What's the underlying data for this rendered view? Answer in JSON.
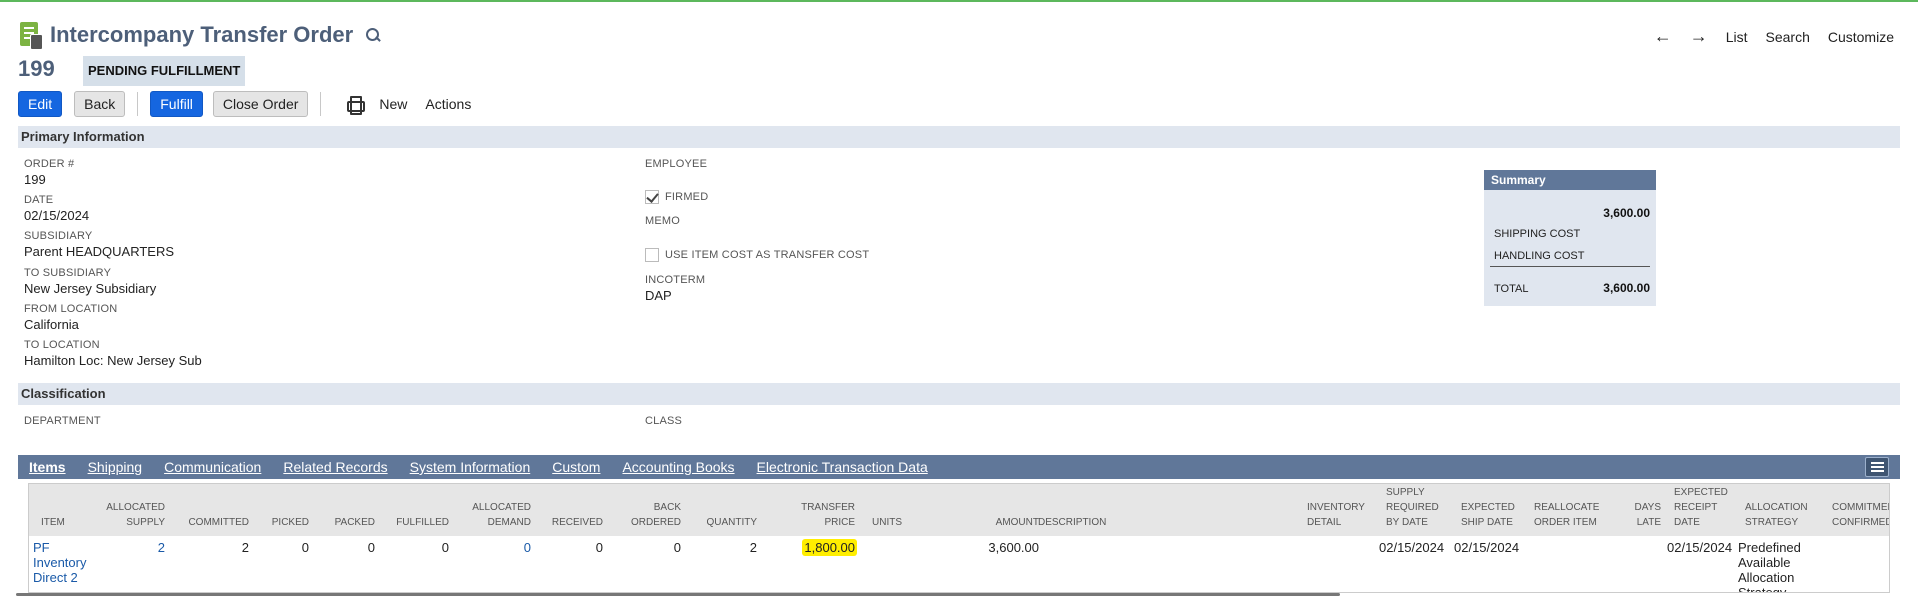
{
  "header": {
    "title": "Intercompany Transfer Order",
    "order_id": "199",
    "status": "PENDING FULFILLMENT"
  },
  "nav": {
    "back_arrow": "←",
    "forward_arrow": "→",
    "list": "List",
    "search": "Search",
    "customize": "Customize"
  },
  "toolbar": {
    "edit": "Edit",
    "back": "Back",
    "fulfill": "Fulfill",
    "close_order": "Close Order",
    "new": "New",
    "actions": "Actions"
  },
  "primary": {
    "section_title": "Primary Information",
    "order_label": "ORDER #",
    "order_value": "199",
    "date_label": "DATE",
    "date_value": "02/15/2024",
    "subsidiary_label": "SUBSIDIARY",
    "subsidiary_value": "Parent HEADQUARTERS",
    "to_subsidiary_label": "TO SUBSIDIARY",
    "to_subsidiary_value": "New Jersey Subsidiary",
    "from_location_label": "FROM LOCATION",
    "from_location_value": "California",
    "to_location_label": "TO LOCATION",
    "to_location_value": "Hamilton Loc: New Jersey Sub",
    "employee_label": "EMPLOYEE",
    "firmed_label": "FIRMED",
    "firmed_checked": true,
    "memo_label": "MEMO",
    "use_item_cost_label": "USE ITEM COST AS TRANSFER COST",
    "use_item_cost_checked": false,
    "incoterm_label": "INCOTERM",
    "incoterm_value": "DAP"
  },
  "summary": {
    "title": "Summary",
    "subtotal": "3,600.00",
    "shipping_cost_label": "SHIPPING COST",
    "handling_cost_label": "HANDLING COST",
    "total_label": "TOTAL",
    "total_value": "3,600.00"
  },
  "classification": {
    "section_title": "Classification",
    "department_label": "DEPARTMENT",
    "class_label": "CLASS"
  },
  "tabs": [
    {
      "label": "Items",
      "active": true
    },
    {
      "label": "Shipping",
      "active": false
    },
    {
      "label": "Communication",
      "active": false
    },
    {
      "label": "Related Records",
      "active": false
    },
    {
      "label": "System Information",
      "active": false
    },
    {
      "label": "Custom",
      "active": false
    },
    {
      "label": "Accounting Books",
      "active": false
    },
    {
      "label": "Electronic Transaction Data",
      "active": false
    }
  ],
  "items_table": {
    "columns": [
      "ITEM",
      "ALLOCATED SUPPLY",
      "COMMITTED",
      "PICKED",
      "PACKED",
      "FULFILLED",
      "ALLOCATED DEMAND",
      "RECEIVED",
      "BACK ORDERED",
      "QUANTITY",
      "TRANSFER PRICE",
      "UNITS",
      "AMOUNT",
      "DESCRIPTION",
      "INVENTORY DETAIL",
      "SUPPLY REQUIRED BY DATE",
      "EXPECTED SHIP DATE",
      "REALLOCATE ORDER ITEM",
      "DAYS LATE",
      "EXPECTED RECEIPT DATE",
      "ALLOCATION STRATEGY",
      "COMMITMEN CONFIRMED"
    ],
    "rows": [
      {
        "item": "PF Inventory Direct 2",
        "allocated_supply": "2",
        "committed": "2",
        "picked": "0",
        "packed": "0",
        "fulfilled": "0",
        "allocated_demand": "0",
        "received": "0",
        "back_ordered": "0",
        "quantity": "2",
        "transfer_price": "1,800.00",
        "units": "",
        "amount": "3,600.00",
        "description": "",
        "inventory_detail": "",
        "supply_required_by_date": "02/15/2024",
        "expected_ship_date": "02/15/2024",
        "reallocate_order_item": "",
        "days_late": "",
        "expected_receipt_date": "02/15/2024",
        "allocation_strategy": "Predefined Available Allocation Strategy",
        "commitment_confirmed": ""
      }
    ]
  },
  "colors": {
    "title": "#4d5f79",
    "primary_button": "#1566e0",
    "section_bar": "#e0e6ef",
    "tab_bar": "#607799",
    "highlight": "#ffee00",
    "link": "#1a5aa8"
  }
}
